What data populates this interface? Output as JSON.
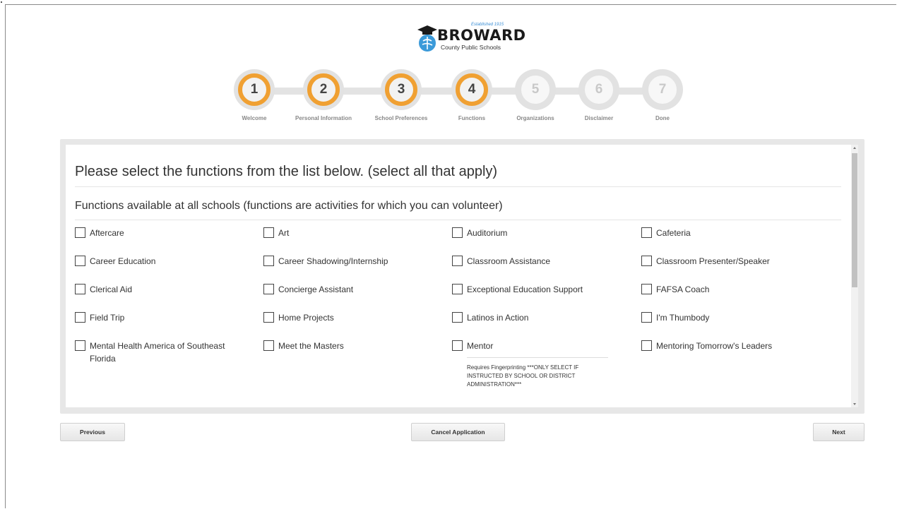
{
  "logo": {
    "established": "Established 1915",
    "name": "BROWARD",
    "subtitle": "County Public Schools"
  },
  "steps": [
    {
      "number": "1",
      "label": "Welcome",
      "active": true
    },
    {
      "number": "2",
      "label": "Personal Information",
      "active": true
    },
    {
      "number": "3",
      "label": "School Preferences",
      "active": true
    },
    {
      "number": "4",
      "label": "Functions",
      "active": true
    },
    {
      "number": "5",
      "label": "Organizations",
      "active": false
    },
    {
      "number": "6",
      "label": "Disclaimer",
      "active": false
    },
    {
      "number": "7",
      "label": "Done",
      "active": false
    }
  ],
  "form": {
    "heading": "Please select the functions from the list below. (select all that apply)",
    "subheading": "Functions available at all schools (functions are activities for which you can volunteer)",
    "functions": [
      {
        "label": "Aftercare",
        "checked": false
      },
      {
        "label": "Art",
        "checked": false
      },
      {
        "label": "Auditorium",
        "checked": false
      },
      {
        "label": "Cafeteria",
        "checked": false
      },
      {
        "label": "Career Education",
        "checked": false
      },
      {
        "label": "Career Shadowing/Internship",
        "checked": false
      },
      {
        "label": "Classroom Assistance",
        "checked": false
      },
      {
        "label": "Classroom Presenter/Speaker",
        "checked": false
      },
      {
        "label": "Clerical Aid",
        "checked": false
      },
      {
        "label": "Concierge Assistant",
        "checked": false
      },
      {
        "label": "Exceptional Education Support",
        "checked": false
      },
      {
        "label": "FAFSA Coach",
        "checked": false
      },
      {
        "label": "Field Trip",
        "checked": false
      },
      {
        "label": "Home Projects",
        "checked": false
      },
      {
        "label": "Latinos in Action",
        "checked": false
      },
      {
        "label": "I'm Thumbody",
        "checked": false
      },
      {
        "label": "Mental Health America of Southeast Florida",
        "checked": false
      },
      {
        "label": "Meet the Masters",
        "checked": false
      },
      {
        "label": "Mentor",
        "checked": false,
        "note": "Requires Fingerprinting ***ONLY SELECT IF INSTRUCTED BY SCHOOL OR DISTRICT ADMINISTRATION***"
      },
      {
        "label": "Mentoring Tomorrow's Leaders",
        "checked": false
      }
    ]
  },
  "buttons": {
    "previous": "Previous",
    "cancel": "Cancel Application",
    "next": "Next"
  },
  "colors": {
    "accent": "#f0a032",
    "inactive": "#e2e2e2"
  }
}
